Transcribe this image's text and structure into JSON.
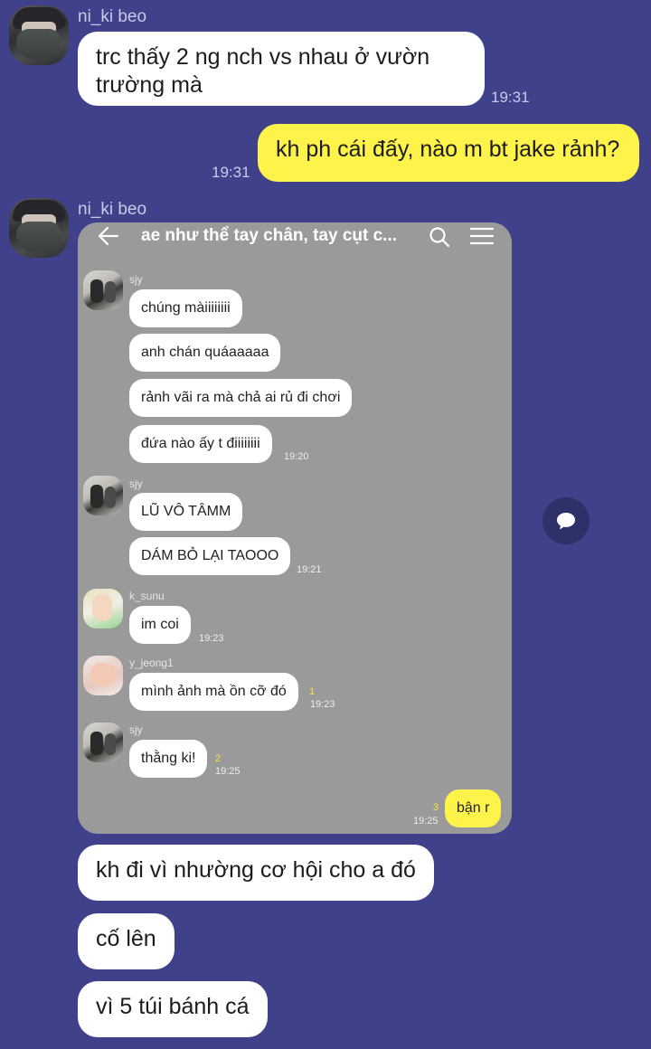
{
  "colors": {
    "background": "#3f418a",
    "bubble_in": "#ffffff",
    "bubble_out": "#fef34a"
  },
  "messages_top": {
    "sender1": "ni_ki beo",
    "msg1": "trc thấy 2 ng nch vs nhau ở vườn",
    "msg1_line2": "trường mà",
    "time1": "19:31",
    "msg2": "kh ph cái đấy, nào m bt jake rảnh?",
    "time2": "19:31",
    "sender2": "ni_ki beo"
  },
  "screenshot": {
    "title": "ae như thể tay chân, tay cụt c...",
    "icons": {
      "back": "back-arrow-icon",
      "search": "search-icon",
      "menu": "menu-icon"
    },
    "groups": [
      {
        "name": "sjy",
        "messages": [
          "chúng màiiiiiiii",
          "anh chán quáaaaaa",
          "rảnh vãi ra mà chả ai rủ đi chơi",
          "đứa nào ấy t điiiiiiii"
        ],
        "time": "19:20"
      },
      {
        "name": "sjy",
        "messages": [
          "LŨ VÔ TÂMM",
          "DÁM BỎ LẠI TAOOO"
        ],
        "time": "19:21"
      },
      {
        "name": "k_sunu",
        "messages": [
          "im coi"
        ],
        "time": "19:23"
      },
      {
        "name": "y_jeong1",
        "messages": [
          "mình ảnh mà ồn cỡ đó"
        ],
        "unread": "1",
        "time": "19:23"
      },
      {
        "name": "sjy",
        "messages": [
          "thằng ki!"
        ],
        "unread": "2",
        "time": "19:25"
      }
    ],
    "outgoing": {
      "text": "bận r",
      "unread": "3",
      "time": "19:25"
    }
  },
  "messages_bottom": [
    "kh đi vì nhường cơ hội cho a đó",
    "cố lên",
    "vì 5 túi bánh cá"
  ],
  "fab_icon": "chat-bubble-icon"
}
